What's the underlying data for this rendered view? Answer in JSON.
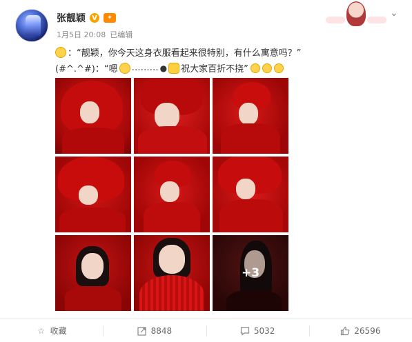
{
  "post": {
    "username": "张靓颖",
    "verified_badge": "V",
    "member_badge": "vip",
    "date": "1月5日 20:08",
    "edited": "已编辑",
    "line1": "：“靓颖，你今天这身衣服看起来很特别，有什么寓意吗？”",
    "line2_prefix": "(#^.^#)：“嗯",
    "line2_dots": "………",
    "line2_text": "祝大家百折不挠”",
    "more_count": "+3"
  },
  "actions": {
    "collect": "收藏",
    "repost_count": "8848",
    "comment_count": "5032",
    "like_count": "26596"
  },
  "icons": {
    "chevron": "chevron-down-icon",
    "collect": "star-icon",
    "repost": "repost-icon",
    "comment": "comment-icon",
    "like": "thumbs-up-icon"
  },
  "colors": {
    "photo_red": "#c40c0c",
    "accent_orange": "#f7a400",
    "text_gray": "#888888"
  }
}
